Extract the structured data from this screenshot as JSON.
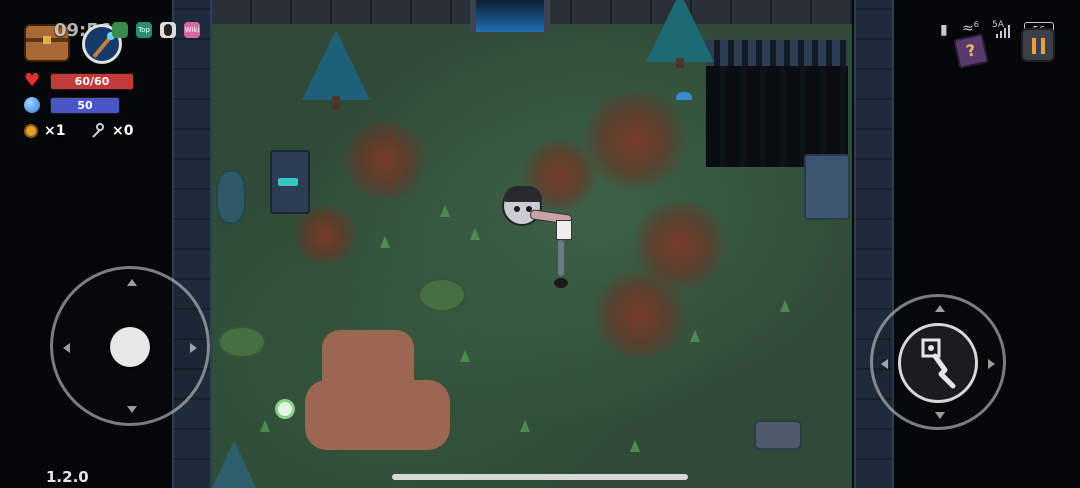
{
  "hud": {
    "time": "09:56",
    "health": {
      "text": "60/60",
      "current": 60,
      "max": 60,
      "color": "#c23a3a"
    },
    "mana": {
      "text": "50",
      "fill": 1.0,
      "color": "#4a56c8"
    },
    "coins": {
      "text": "×1"
    },
    "keys": {
      "text": "×0"
    },
    "version": "1.2.0"
  },
  "status_bar": {
    "battery": "56",
    "network": "5A",
    "wifi_level": "6"
  },
  "app_badges": [
    {
      "icon": "green-app-icon",
      "color": "#3c8a4a"
    },
    {
      "icon": "top-app-icon",
      "label": "Top",
      "color": "#2a8a72"
    },
    {
      "icon": "penguin-app-icon",
      "color": "#dddddd"
    },
    {
      "icon": "pink-app-icon",
      "label": "Wiki",
      "color": "#d86aa0"
    }
  ],
  "icons": {
    "chest": "treasure-chest-icon",
    "weapon": "magic-staff-icon",
    "heart": "heart-icon",
    "mana": "mana-orb-icon",
    "coin": "coin-icon",
    "key": "key-icon",
    "help": "help-book-icon",
    "pause": "pause-icon",
    "attack": "staff-attack-icon"
  },
  "colors": {
    "floor": "#2f4a37",
    "wall": "#1e2b3b",
    "pause_bg": "#3a3f48",
    "pause_bars": "#e8a23a"
  }
}
